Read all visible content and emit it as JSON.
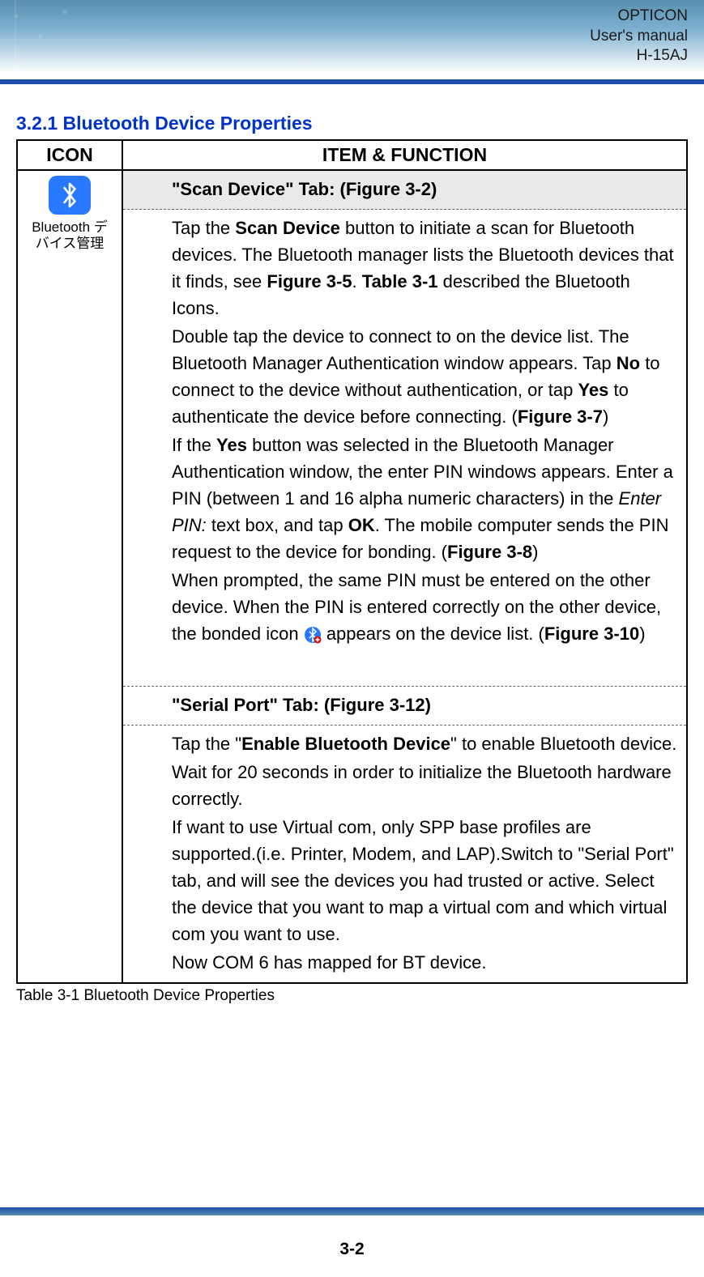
{
  "header": {
    "line1": "OPTICON",
    "line2": "User's manual",
    "line3": "H-15AJ"
  },
  "section_heading": "3.2.1 Bluetooth Device Properties",
  "table": {
    "col_icon": "ICON",
    "col_func": "ITEM & FUNCTION",
    "icon_label_line1": "Bluetooth デ",
    "icon_label_line2": "バイス管理",
    "tab1_title": "\"Scan Device\" Tab: (Figure 3-2)",
    "tab1_items": {
      "i1_pre": "Tap the ",
      "i1_b1": "Scan Device",
      "i1_mid1": " button to initiate a scan for Bluetooth devices. The Bluetooth manager lists the Bluetooth devices that it finds, see ",
      "i1_b2": "Figure 3-5",
      "i1_mid2": ". ",
      "i1_b3": "Table 3-1",
      "i1_post": " described the Bluetooth Icons.",
      "i2_pre": "Double tap the device to connect to on the device list. The Bluetooth Manager Authentication window appears. Tap ",
      "i2_b1": "No",
      "i2_mid1": " to connect to the device without authentication, or tap ",
      "i2_b2": "Yes",
      "i2_mid2": " to authenticate the device before connecting. (",
      "i2_b3": "Figure 3-7",
      "i2_post": ")",
      "i3_pre": "If the ",
      "i3_b1": "Yes",
      "i3_mid1": " button was selected in the Bluetooth Manager Authentication window, the enter PIN windows appears. Enter a PIN (between 1 and 16 alpha numeric characters) in the ",
      "i3_it1": "Enter PIN:",
      "i3_mid2": " text box, and tap ",
      "i3_b2": "OK",
      "i3_mid3": ". The mobile computer sends the PIN request to the device for bonding. (",
      "i3_b3": "Figure 3-8",
      "i3_post": ")",
      "i4_pre": "When prompted, the same PIN must be entered on the other device. When the PIN is entered correctly on the other device, the bonded icon ",
      "i4_mid": " appears on the device list. (",
      "i4_b1": "Figure 3-10",
      "i4_post": ")"
    },
    "tab2_title": "\"Serial Port\" Tab: (Figure 3-12)",
    "tab2_items": {
      "i1_pre": "Tap the \"",
      "i1_b1": "Enable Bluetooth Device",
      "i1_post": "\" to enable Bluetooth device.",
      "i2": "Wait for 20 seconds in order to initialize the Bluetooth hardware correctly.",
      "i3": "If want to use Virtual com, only SPP base profiles are supported.(i.e. Printer, Modem, and LAP).Switch to \"Serial Port\" tab, and will see the devices you had trusted or active. Select the device that you want to map a virtual com and which virtual com you want to use.",
      "i4": "Now COM 6 has mapped for BT device."
    }
  },
  "caption": "Table 3-1 Bluetooth Device Properties",
  "page_number": "3-2"
}
